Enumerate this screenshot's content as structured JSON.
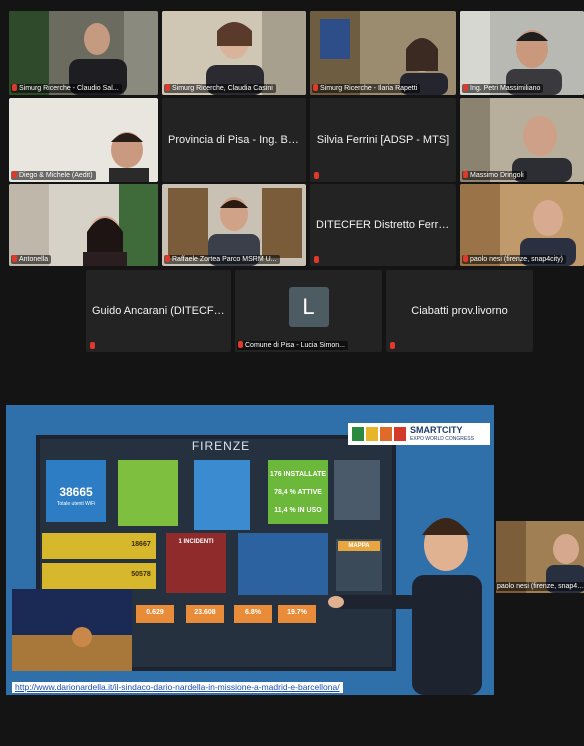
{
  "participants": [
    {
      "id": "p1",
      "label": "Simurg Ricerche - Claudio Sal..."
    },
    {
      "id": "p2",
      "label": "Simurg Ricerche, Claudia Casini"
    },
    {
      "id": "p3",
      "label": "Simurg Ricerche - Ilaria Rapetti"
    },
    {
      "id": "p4",
      "label": "Ing. Petri Massimiliano"
    },
    {
      "id": "p5",
      "label": "Diego & Michele (Aedit)"
    },
    {
      "id": "p6",
      "name": "Provincia di Pisa - Ing. Banti"
    },
    {
      "id": "p7",
      "name": "Silvia Ferrini [ADSP - MTS]"
    },
    {
      "id": "p8",
      "label": "Massimo Dringoli"
    },
    {
      "id": "p9",
      "label": "Antonella"
    },
    {
      "id": "p10",
      "label": "Raffaele Zortea Parco MSRM U..."
    },
    {
      "id": "p11",
      "name": "DITECFER Distretto Ferrovi..."
    },
    {
      "id": "p12",
      "label": "paolo nesi (firenze, snap4city)"
    },
    {
      "id": "p13",
      "name": "Guido Ancarani (DITECFER)"
    },
    {
      "id": "p14",
      "initial": "L",
      "label": "Comune di Pisa - Lucia Simon..."
    },
    {
      "id": "p15",
      "name": "Ciabatti prov.livorno"
    }
  ],
  "share": {
    "thumbnail_label": "paolo nesi (firenze, snap4city)",
    "url": "http://www.darionardella.it/il-sindaco-dario-nardella-in-missione-a-madrid-e-barcellona/",
    "logo_main": "SMARTCITY",
    "logo_sub": "EXPO WORLD CONGRESS",
    "dashboard": {
      "title": "FIRENZE",
      "wifi_value": "38665",
      "wifi_caption": "Totale utenti WiFi",
      "installed": "176 INSTALLATE",
      "active": "78,4 % ATTIVE",
      "in_use": "11,4 % IN USO",
      "incidents": "1 INCIDENTI",
      "mappa": "MAPPA",
      "stat_a": "18667",
      "stat_b": "50578",
      "bottom_1": "0.629",
      "bottom_2": "23.608",
      "bottom_3": "6.8%",
      "bottom_4": "19.7%"
    }
  },
  "colors": {
    "active_speaker": "#c9e26a",
    "mic_muted": "#e0382b"
  }
}
